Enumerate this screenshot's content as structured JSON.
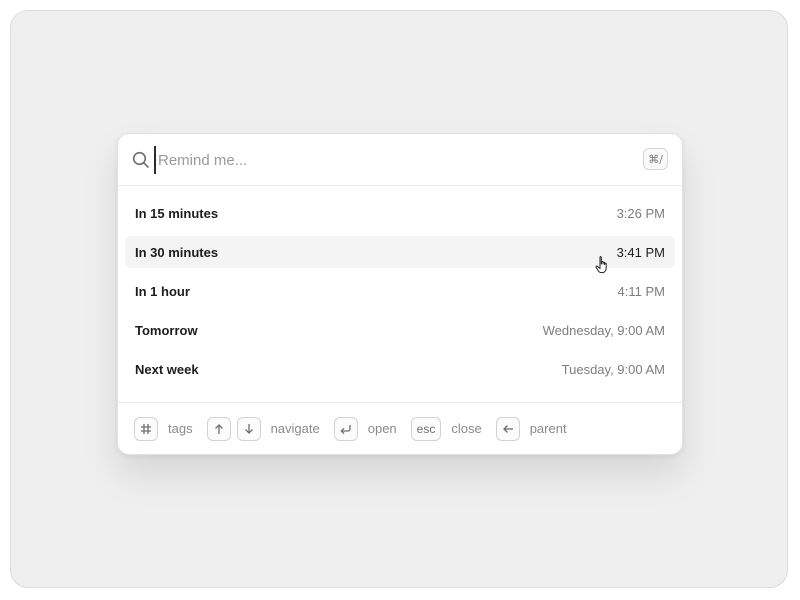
{
  "search": {
    "placeholder": "Remind me...",
    "shortcut": "⌘/"
  },
  "options": [
    {
      "label": "In 15 minutes",
      "time": "3:26 PM"
    },
    {
      "label": "In 30 minutes",
      "time": "3:41 PM"
    },
    {
      "label": "In 1 hour",
      "time": "4:11 PM"
    },
    {
      "label": "Tomorrow",
      "time": "Wednesday, 9:00 AM"
    },
    {
      "label": "Next week",
      "time": "Tuesday, 9:00 AM"
    }
  ],
  "active_option_index": 1,
  "footer": {
    "tags": {
      "icon": "hash-icon",
      "label": "tags"
    },
    "navigate": {
      "icons": [
        "arrow-up-icon",
        "arrow-down-icon"
      ],
      "label": "navigate"
    },
    "open": {
      "icon": "return-icon",
      "label": "open"
    },
    "close": {
      "key": "esc",
      "label": "close"
    },
    "parent": {
      "icon": "arrow-left-icon",
      "label": "parent"
    }
  },
  "colors": {
    "background": "#efefef",
    "panel": "#ffffff",
    "active_row": "#f4f4f4",
    "text_primary": "#1d1d1d",
    "text_secondary": "#7d7d7d"
  }
}
